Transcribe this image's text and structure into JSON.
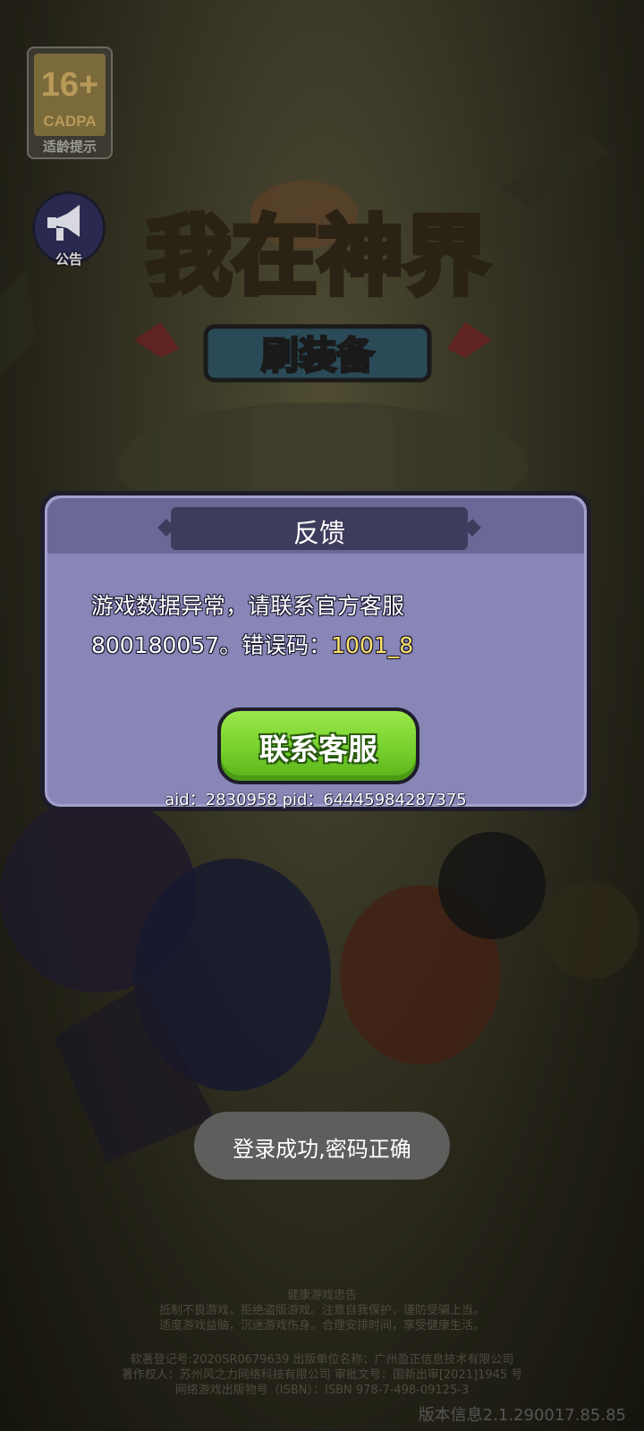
{
  "age_rating": {
    "number": "16+",
    "code": "CADPA",
    "label": "适龄提示"
  },
  "notice": {
    "label": "公告",
    "icon": "megaphone-icon"
  },
  "game_logo": {
    "title": "我在神界",
    "subtitle": "刷装备"
  },
  "dialog": {
    "title": "反馈",
    "message_line1": "游戏数据异常，请联系官方客服",
    "message_line2_prefix": "800180057。错误码：",
    "error_code": "1001_8",
    "button_label": "联系客服",
    "ids": "aid：2830958 pid：64445984287375"
  },
  "toast": {
    "text": "登录成功,密码正确"
  },
  "footer": {
    "health_title": "健康游戏忠告",
    "health_line1": "抵制不良游戏，拒绝盗版游戏。注意自我保护，谨防受骗上当。",
    "health_line2": "适度游戏益脑，沉迷游戏伤身。合理安排时间，享受健康生活。",
    "license_line1": "软著登记号:2020SR0679639 出版单位名称：广州盈正信息技术有限公司",
    "license_line2": "著作权人：苏州风之力网络科技有限公司 审批文号：国新出审[2021]1945 号",
    "license_line3": "网络游戏出版物号（ISBN）：ISBN 978-7-498-09125-3",
    "version": "版本信息2.1.290017.85.85"
  },
  "colors": {
    "button_green": "#76d02c",
    "dialog_bg": "#8886b6",
    "error_code": "#ffe36a"
  }
}
